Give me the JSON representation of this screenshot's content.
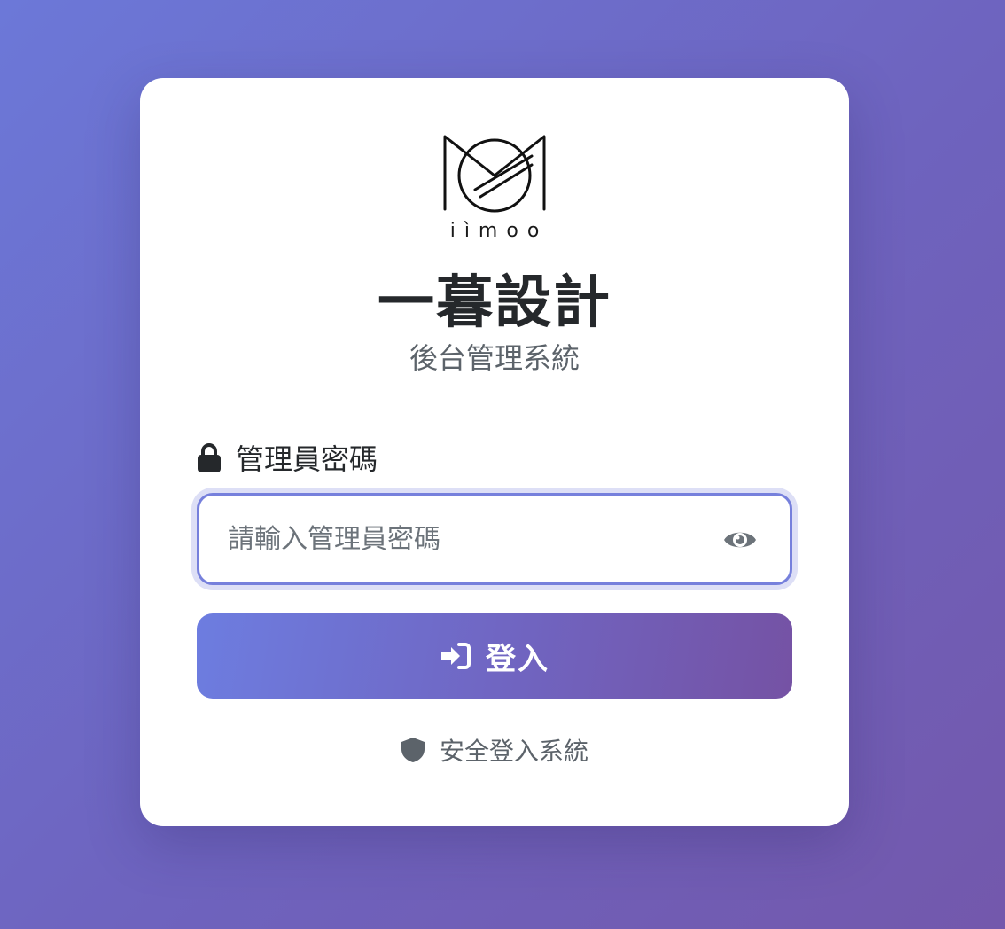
{
  "brand": {
    "logo_text": "iìmoo",
    "title": "一暮設計",
    "subtitle": "後台管理系統"
  },
  "password_field": {
    "label": "管理員密碼",
    "placeholder": "請輸入管理員密碼",
    "value": "",
    "label_icon": "lock-icon",
    "toggle_icon": "eye-icon"
  },
  "login_button": {
    "label": "登入",
    "icon": "sign-in-icon"
  },
  "footer": {
    "secure_text": "安全登入系統",
    "icon": "shield-icon"
  },
  "colors": {
    "background_start": "#6c78d8",
    "background_end": "#7358ac",
    "accent": "#7680dc",
    "button_start": "#6d7de0",
    "button_end": "#7552a4",
    "title_text": "#25282b",
    "muted_text": "#5c636a"
  }
}
